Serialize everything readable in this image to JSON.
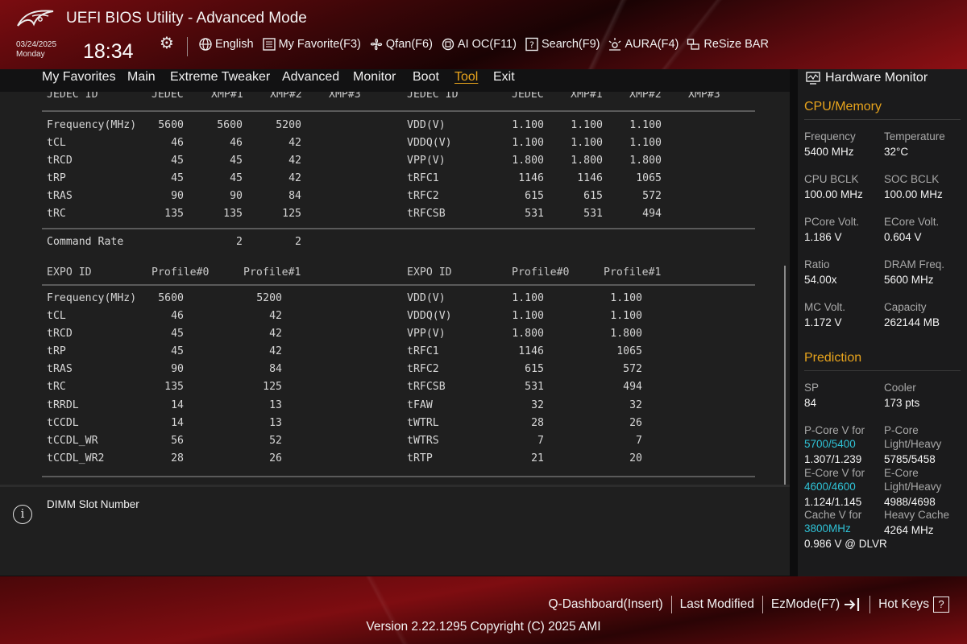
{
  "header": {
    "title": "UEFI BIOS Utility - Advanced Mode",
    "date": "03/24/2025",
    "day": "Monday",
    "time": "18:34",
    "toolbar": [
      {
        "label": "English",
        "icon": "globe-icon"
      },
      {
        "label": "My Favorite(F3)",
        "icon": "favorite-list-icon"
      },
      {
        "label": "Qfan(F6)",
        "icon": "fan-icon"
      },
      {
        "label": "AI OC(F11)",
        "icon": "ai-chip-icon"
      },
      {
        "label": "Search(F9)",
        "icon": "search-help-icon"
      },
      {
        "label": "AURA(F4)",
        "icon": "aura-light-icon"
      },
      {
        "label": "ReSize BAR",
        "icon": "resize-bar-icon"
      }
    ]
  },
  "nav": {
    "items": [
      "My Favorites",
      "Main",
      "Extreme Tweaker",
      "Advanced",
      "Monitor",
      "Boot",
      "Tool",
      "Exit"
    ],
    "active": "Tool"
  },
  "jedec": {
    "headers_left": [
      "JEDEC ID",
      "JEDEC",
      "XMP#1",
      "XMP#2",
      "XMP#3"
    ],
    "headers_right": [
      "JEDEC ID",
      "JEDEC",
      "XMP#1",
      "XMP#2",
      "XMP#3"
    ],
    "left_rows": [
      {
        "label": "Frequency(MHz)",
        "v1": "5600",
        "v2": "5600",
        "v3": "5200"
      },
      {
        "label": "tCL",
        "v1": "46",
        "v2": "46",
        "v3": "42"
      },
      {
        "label": "tRCD",
        "v1": "45",
        "v2": "45",
        "v3": "42"
      },
      {
        "label": "tRP",
        "v1": "45",
        "v2": "45",
        "v3": "42"
      },
      {
        "label": "tRAS",
        "v1": "90",
        "v2": "90",
        "v3": "84"
      },
      {
        "label": "tRC",
        "v1": "135",
        "v2": "135",
        "v3": "125"
      }
    ],
    "right_rows": [
      {
        "label": "VDD(V)",
        "v1": "1.100",
        "v2": "1.100",
        "v3": "1.100"
      },
      {
        "label": "VDDQ(V)",
        "v1": "1.100",
        "v2": "1.100",
        "v3": "1.100"
      },
      {
        "label": "VPP(V)",
        "v1": "1.800",
        "v2": "1.800",
        "v3": "1.800"
      },
      {
        "label": "tRFC1",
        "v1": "1146",
        "v2": "1146",
        "v3": "1065"
      },
      {
        "label": "tRFC2",
        "v1": "615",
        "v2": "615",
        "v3": "572"
      },
      {
        "label": "tRFCSB",
        "v1": "531",
        "v2": "531",
        "v3": "494"
      }
    ],
    "command_rate": {
      "label": "Command Rate",
      "v2": "2",
      "v3": "2"
    }
  },
  "expo": {
    "headers_left": [
      "EXPO ID",
      "Profile#0",
      "Profile#1"
    ],
    "headers_right": [
      "EXPO ID",
      "Profile#0",
      "Profile#1"
    ],
    "left_rows": [
      {
        "label": "Frequency(MHz)",
        "p0": "5600",
        "p1": "5200"
      },
      {
        "label": "tCL",
        "p0": "46",
        "p1": "42"
      },
      {
        "label": "tRCD",
        "p0": "45",
        "p1": "42"
      },
      {
        "label": "tRP",
        "p0": "45",
        "p1": "42"
      },
      {
        "label": "tRAS",
        "p0": "90",
        "p1": "84"
      },
      {
        "label": "tRC",
        "p0": "135",
        "p1": "125"
      },
      {
        "label": "tRRDL",
        "p0": "14",
        "p1": "13"
      },
      {
        "label": "tCCDL",
        "p0": "14",
        "p1": "13"
      },
      {
        "label": "tCCDL_WR",
        "p0": "56",
        "p1": "52"
      },
      {
        "label": "tCCDL_WR2",
        "p0": "28",
        "p1": "26"
      }
    ],
    "right_rows": [
      {
        "label": "VDD(V)",
        "p0": "1.100",
        "p1": "1.100"
      },
      {
        "label": "VDDQ(V)",
        "p0": "1.100",
        "p1": "1.100"
      },
      {
        "label": "VPP(V)",
        "p0": "1.800",
        "p1": "1.800"
      },
      {
        "label": "tRFC1",
        "p0": "1146",
        "p1": "1065"
      },
      {
        "label": "tRFC2",
        "p0": "615",
        "p1": "572"
      },
      {
        "label": "tRFCSB",
        "p0": "531",
        "p1": "494"
      },
      {
        "label": "tFAW",
        "p0": "32",
        "p1": "32"
      },
      {
        "label": "tWTRL",
        "p0": "28",
        "p1": "26"
      },
      {
        "label": "tWTRS",
        "p0": "7",
        "p1": "7"
      },
      {
        "label": "tRTP",
        "p0": "21",
        "p1": "20"
      }
    ]
  },
  "help": {
    "text": "DIMM Slot Number"
  },
  "hardware_monitor": {
    "title": "Hardware Monitor",
    "cpu_memory": {
      "heading": "CPU/Memory",
      "items": [
        {
          "label": "Frequency",
          "value": "5400 MHz"
        },
        {
          "label": "Temperature",
          "value": "32°C"
        },
        {
          "label": "CPU BCLK",
          "value": "100.00 MHz"
        },
        {
          "label": "SOC BCLK",
          "value": "100.00 MHz"
        },
        {
          "label": "PCore Volt.",
          "value": "1.186 V"
        },
        {
          "label": "ECore Volt.",
          "value": "0.604 V"
        },
        {
          "label": "Ratio",
          "value": "54.00x"
        },
        {
          "label": "DRAM Freq.",
          "value": "5600 MHz"
        },
        {
          "label": "MC Volt.",
          "value": "1.172 V"
        },
        {
          "label": "Capacity",
          "value": "262144 MB"
        }
      ]
    },
    "prediction": {
      "heading": "Prediction",
      "sp_label": "SP",
      "sp_value": "84",
      "cooler_label": "Cooler",
      "cooler_value": "173 pts",
      "pcore_label": "P-Core V for",
      "pcore_freq": "5700/5400",
      "pcore_value": "1.307/1.239",
      "pcore_lh_label1": "P-Core",
      "pcore_lh_label2": "Light/Heavy",
      "pcore_lh_value": "5785/5458",
      "ecore_label": "E-Core V for",
      "ecore_freq": "4600/4600",
      "ecore_value": "1.124/1.145",
      "ecore_lh_label1": "E-Core",
      "ecore_lh_label2": "Light/Heavy",
      "ecore_lh_value": "4988/4698",
      "cache_label": "Cache V for",
      "cache_freq": "3800MHz",
      "cache_value": "0.986 V @ DLVR",
      "heavy_cache_label": "Heavy Cache",
      "heavy_cache_value": "4264 MHz"
    }
  },
  "footer": {
    "items": [
      {
        "label": "Q-Dashboard(Insert)"
      },
      {
        "label": "Last Modified"
      },
      {
        "label": "EzMode(F7)",
        "icon": "exit-arrow-icon"
      },
      {
        "label": "Hot Keys",
        "icon": "question-key-icon"
      }
    ],
    "version": "Version 2.22.1295 Copyright (C) 2025 AMI"
  },
  "colors": {
    "accent": "#e8a41c",
    "cyan": "#2fc2d6",
    "brand_red": "#7e0d11",
    "panel": "#1f1f1f"
  }
}
